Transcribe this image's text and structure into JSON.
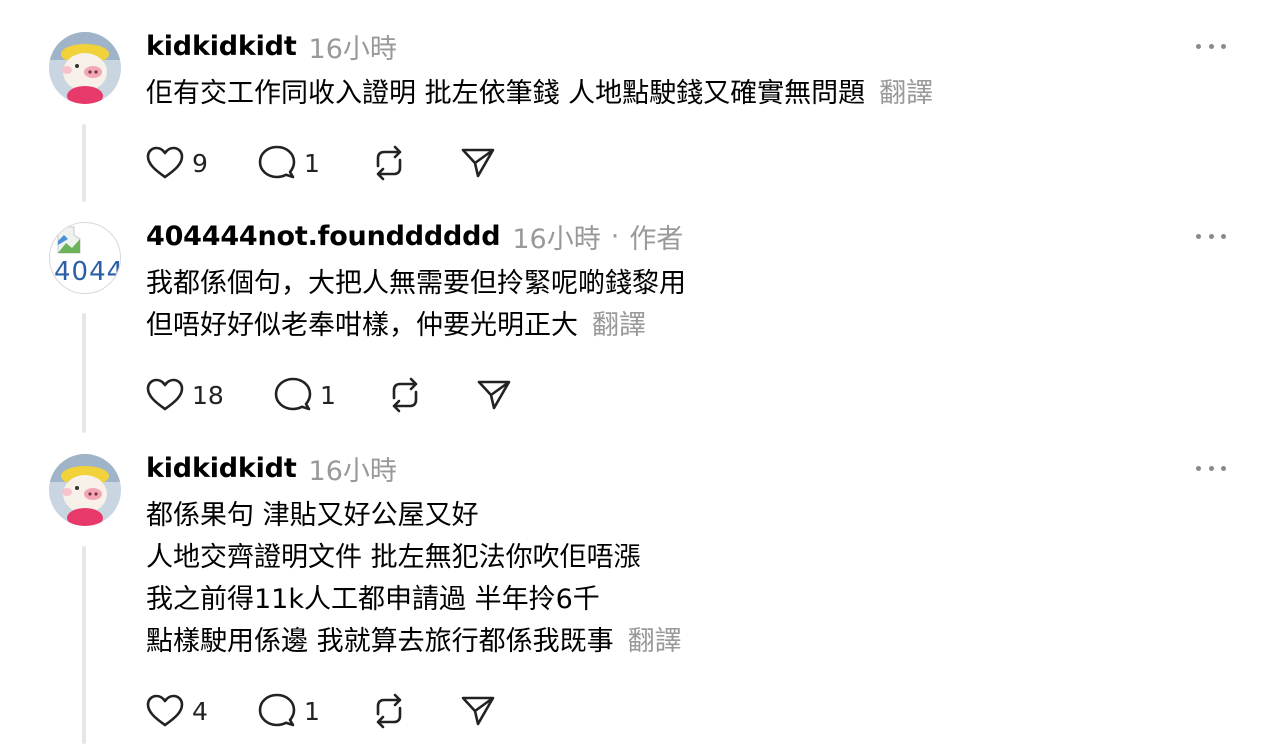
{
  "posts": [
    {
      "username": "kidkidkidt",
      "time": "16小時",
      "author_tag": "",
      "lines": [
        "佢有交工作同收入證明 批左依筆錢 人地點駛錢又確實無問題"
      ],
      "translate_label": "翻譯",
      "likes": "9",
      "replies": "1",
      "avatar_icon": "pig-avatar"
    },
    {
      "username": "404444not.foundddddd",
      "time": "16小時",
      "author_tag": "作者",
      "separator": "·",
      "lines": [
        "我都係個句，大把人無需要但拎緊呢啲錢黎用",
        "但唔好好似老奉咁樣，仲要光明正大"
      ],
      "translate_label": "翻譯",
      "likes": "18",
      "replies": "1",
      "avatar_text": "4044"
    },
    {
      "username": "kidkidkidt",
      "time": "16小時",
      "author_tag": "",
      "lines": [
        "都係果句 津貼又好公屋又好",
        "人地交齊證明文件 批左無犯法你吹佢唔漲",
        "我之前得11k人工都申請過 半年拎6千",
        "點樣駛用係邊 我就算去旅行都係我既事"
      ],
      "translate_label": "翻譯",
      "likes": "4",
      "replies": "1",
      "avatar_icon": "pig-avatar"
    }
  ],
  "colors": {
    "muted": "#999999",
    "thread": "#e6e6e6",
    "text": "#000000"
  }
}
